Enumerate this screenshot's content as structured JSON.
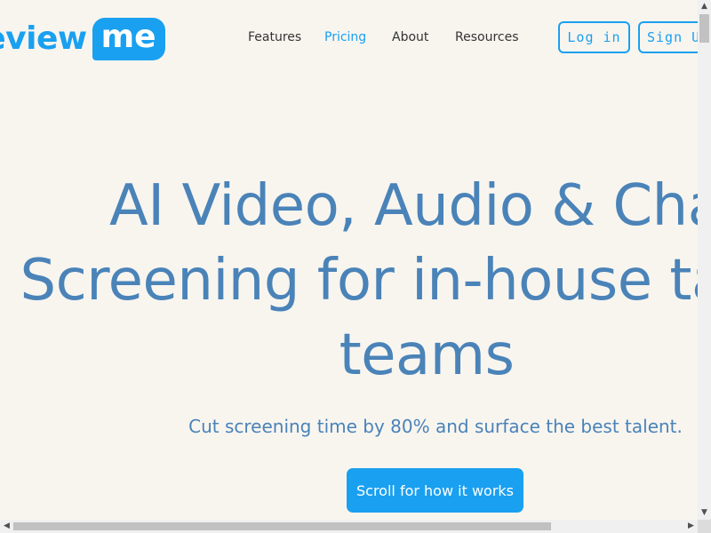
{
  "logo": {
    "part1": "review",
    "part2": "me"
  },
  "nav": [
    {
      "label": "Features",
      "active": false
    },
    {
      "label": "Pricing",
      "active": true
    },
    {
      "label": "About",
      "active": false
    },
    {
      "label": "Resources",
      "active": false
    }
  ],
  "auth": {
    "login": "Log in",
    "signup": "Sign Up"
  },
  "hero": {
    "title_lines": [
      "AI Video, Audio & Chat",
      "Screening for in-house talent",
      "teams"
    ],
    "subtitle": "Cut screening time by 80% and surface the best talent.",
    "cta": "Scroll for how it works"
  },
  "icons": {
    "scroll_up": "▲",
    "scroll_down": "▼",
    "scroll_left": "◀",
    "scroll_right": "▶"
  },
  "colors": {
    "brand": "#1aa0f0",
    "hero_text": "#4a83b8",
    "background": "#f8f5ef"
  }
}
